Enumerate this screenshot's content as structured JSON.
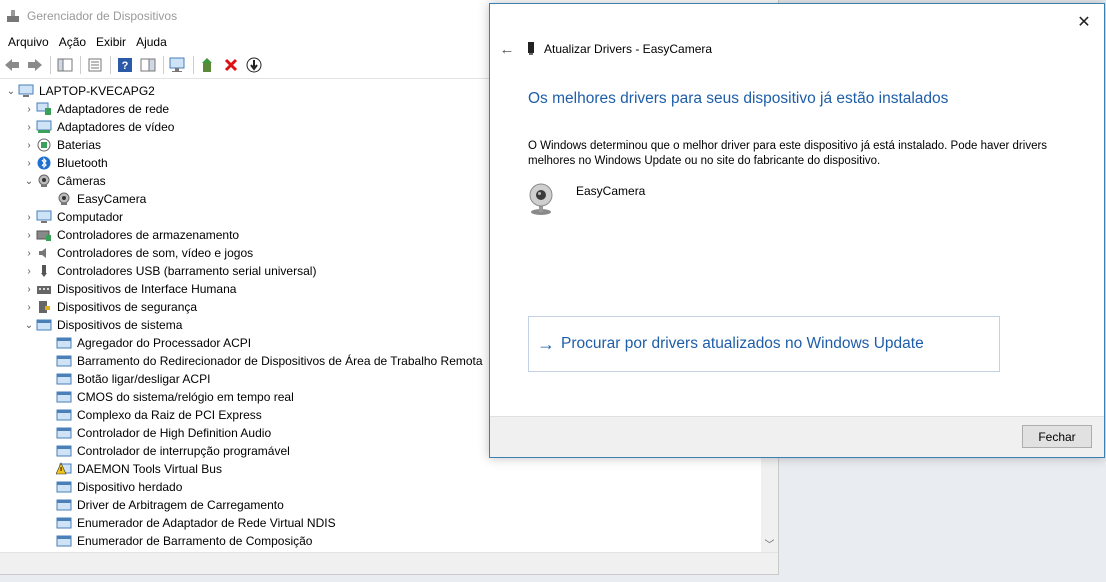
{
  "window": {
    "title": "Gerenciador de Dispositivos"
  },
  "menu": [
    "Arquivo",
    "Ação",
    "Exibir",
    "Ajuda"
  ],
  "tree": {
    "root": "LAPTOP-KVECAPG2",
    "items": [
      {
        "label": "Adaptadores de rede",
        "icon": "network-icon",
        "chev": "›"
      },
      {
        "label": "Adaptadores de vídeo",
        "icon": "display-adapter-icon",
        "chev": "›"
      },
      {
        "label": "Baterias",
        "icon": "battery-icon",
        "chev": "›"
      },
      {
        "label": "Bluetooth",
        "icon": "bluetooth-icon",
        "chev": "›"
      },
      {
        "label": "Câmeras",
        "icon": "camera-icon",
        "chev": "⌄"
      },
      {
        "label": "EasyCamera",
        "icon": "webcam-icon",
        "child": true
      },
      {
        "label": "Computador",
        "icon": "computer-icon",
        "chev": "›"
      },
      {
        "label": "Controladores de armazenamento",
        "icon": "storage-icon",
        "chev": "›"
      },
      {
        "label": "Controladores de som, vídeo e jogos",
        "icon": "sound-icon",
        "chev": "›"
      },
      {
        "label": "Controladores USB (barramento serial universal)",
        "icon": "usb-icon",
        "chev": "›"
      },
      {
        "label": "Dispositivos de Interface Humana",
        "icon": "keyboard-icon",
        "chev": "›"
      },
      {
        "label": "Dispositivos de segurança",
        "icon": "security-icon",
        "chev": "›"
      },
      {
        "label": "Dispositivos de sistema",
        "icon": "system-folder-icon",
        "chev": "⌄"
      },
      {
        "label": "Agregador do Processador ACPI",
        "icon": "system-device-icon",
        "child": true
      },
      {
        "label": "Barramento do Redirecionador de Dispositivos de Área de Trabalho Remota",
        "icon": "system-device-icon",
        "child": true
      },
      {
        "label": "Botão ligar/desligar ACPI",
        "icon": "system-device-icon",
        "child": true
      },
      {
        "label": "CMOS do sistema/relógio em tempo real",
        "icon": "system-device-icon",
        "child": true
      },
      {
        "label": "Complexo da Raiz de PCI Express",
        "icon": "system-device-icon",
        "child": true
      },
      {
        "label": "Controlador de High Definition Audio",
        "icon": "system-device-icon",
        "child": true
      },
      {
        "label": "Controlador de interrupção programável",
        "icon": "system-device-icon",
        "child": true
      },
      {
        "label": "DAEMON Tools Virtual Bus",
        "icon": "warning-icon",
        "child": true
      },
      {
        "label": "Dispositivo herdado",
        "icon": "system-device-icon",
        "child": true
      },
      {
        "label": "Driver de Arbitragem de Carregamento",
        "icon": "system-device-icon",
        "child": true
      },
      {
        "label": "Enumerador de Adaptador de Rede Virtual NDIS",
        "icon": "system-device-icon",
        "child": true
      },
      {
        "label": "Enumerador de Barramento de Composição",
        "icon": "system-device-icon",
        "child": true
      }
    ]
  },
  "dialog": {
    "title": "Atualizar Drivers - EasyCamera",
    "heading": "Os melhores drivers para seus dispositivo já estão instalados",
    "description": "O Windows determinou que o melhor driver para este dispositivo já está instalado. Pode haver drivers melhores no Windows Update ou no site do fabricante do dispositivo.",
    "device_name": "EasyCamera",
    "link": "Procurar por drivers atualizados no Windows Update",
    "close_button": "Fechar"
  },
  "colors": {
    "accent": "#1e5ea8",
    "dialog_border": "#3c7fb1"
  }
}
